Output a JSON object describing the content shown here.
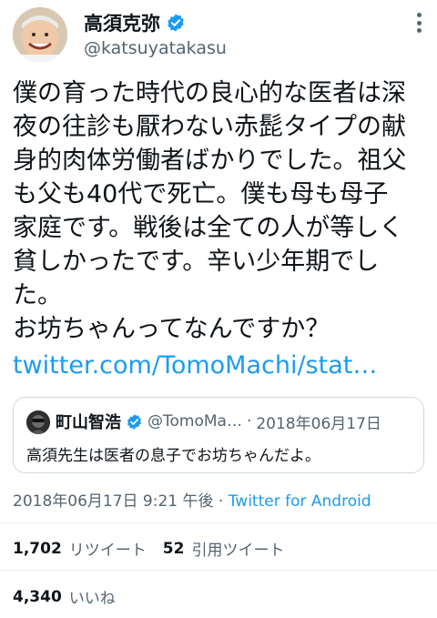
{
  "author": {
    "display_name": "高須克弥",
    "handle": "@katsuyatakasu",
    "verified": true
  },
  "body_lines": [
    "僕の育った時代の良心的な医者は深",
    "夜の往診も厭わない赤髭タイプの献",
    "身的肉体労働者ばかりでした。祖父",
    "も父も40代で死亡。僕も母も母子",
    "家庭です。戦後は全ての人が等しく",
    "貧しかったです。辛い少年期でし",
    "た。",
    "お坊ちゃんってなんですか？"
  ],
  "link_text": "twitter.com/TomoMachi/stat…",
  "quote": {
    "display_name": "町山智浩",
    "handle": "@TomoMa…",
    "separator": "·",
    "date": "2018年06月17日",
    "text": "高須先生は医者の息子でお坊ちゃんだよ。"
  },
  "meta": {
    "timestamp": "2018年06月17日 9:21 午後",
    "separator": " · ",
    "source": "Twitter for Android"
  },
  "stats": {
    "retweets_count": "1,702",
    "retweets_label": "リツイート",
    "quotes_count": "52",
    "quotes_label": "引用ツイート",
    "likes_count": "4,340",
    "likes_label": "いいね"
  },
  "icons": {
    "verified": "verified-badge-icon",
    "more": "more-vertical-icon"
  },
  "colors": {
    "accent": "#1d9bf0",
    "text": "#0f1419",
    "secondary": "#536471",
    "border": "#cfd9de"
  }
}
